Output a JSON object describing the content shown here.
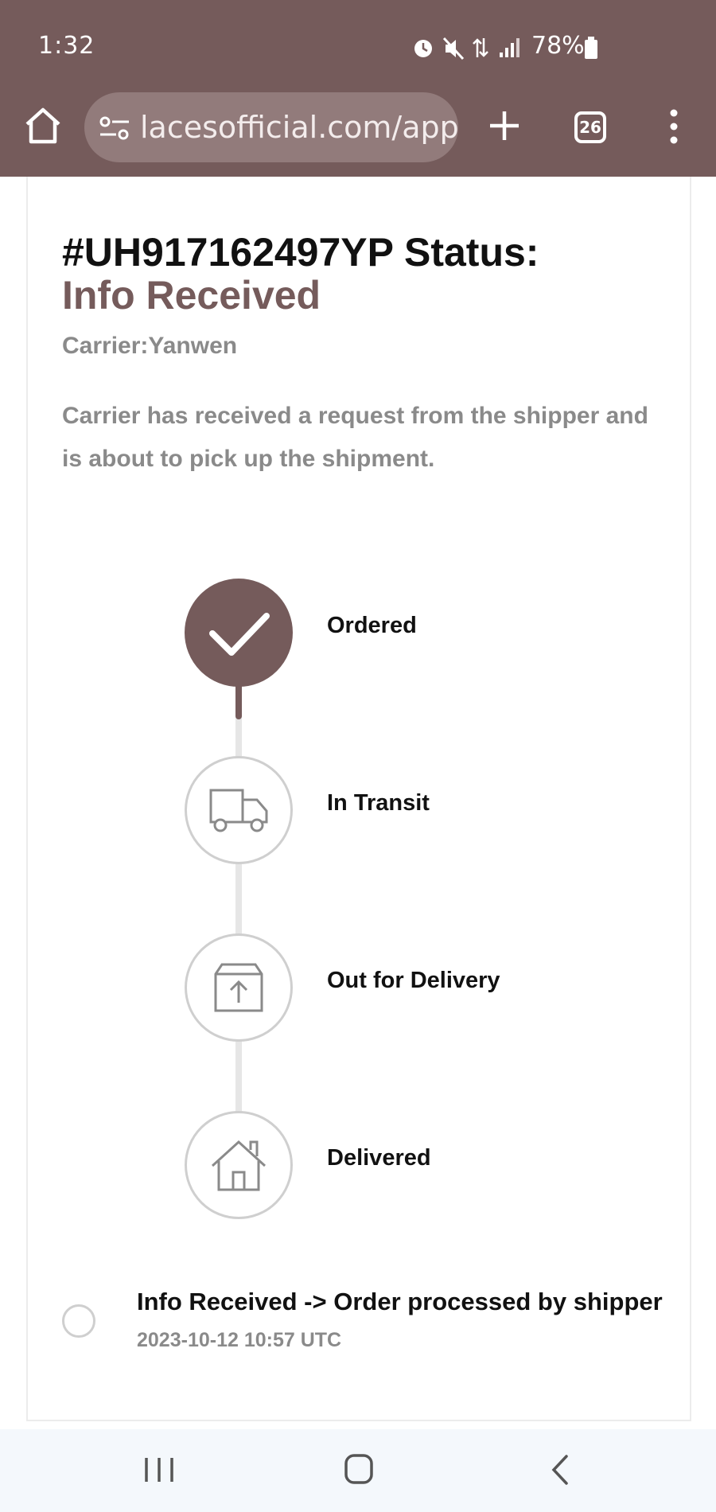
{
  "status_bar": {
    "time": "1:32",
    "battery": "78%"
  },
  "browser": {
    "url": "lacesofficial.com/app",
    "tab_count": "26"
  },
  "tracking": {
    "title_prefix": "#UH917162497YP Status:",
    "status": "Info Received",
    "carrier": "Carrier:Yanwen",
    "description": "Carrier has received a request from the shipper and is about to pick up the shipment.",
    "steps": [
      {
        "label": "Ordered",
        "icon": "check-icon",
        "done": true
      },
      {
        "label": "In Transit",
        "icon": "truck-icon",
        "done": false
      },
      {
        "label": "Out for Delivery",
        "icon": "package-icon",
        "done": false
      },
      {
        "label": "Delivered",
        "icon": "house-icon",
        "done": false
      }
    ],
    "events": [
      {
        "text": "Info Received -> Order processed by shipper",
        "time": "2023-10-12 10:57 UTC"
      }
    ]
  },
  "colors": {
    "brand": "#755b5b",
    "muted_text": "#8a8a8a",
    "step_border": "#cfcfcf"
  }
}
